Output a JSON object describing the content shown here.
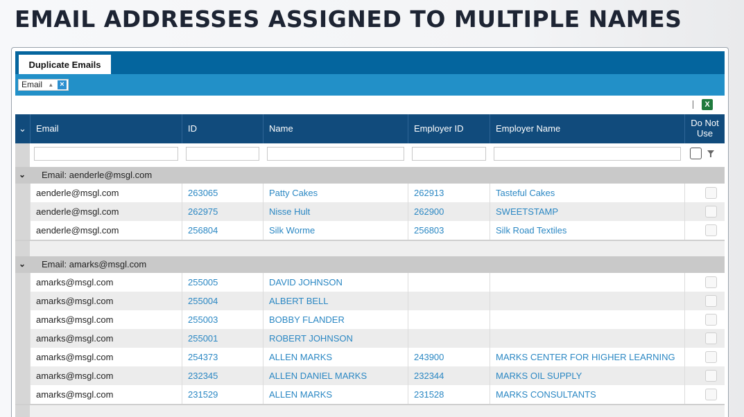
{
  "page": {
    "title": "EMAIL ADDRESSES ASSIGNED TO MULTIPLE NAMES"
  },
  "tabs": [
    {
      "label": "Duplicate Emails",
      "active": true
    }
  ],
  "grouping": {
    "chip_label": "Email",
    "sort_indicator": "▲",
    "remove_label": "×"
  },
  "toolbar": {
    "export_icon": "excel-export-icon",
    "export_glyph": "X"
  },
  "columns": {
    "toggle_glyph": "⌄",
    "email": "Email",
    "id": "ID",
    "name": "Name",
    "employer_id": "Employer ID",
    "employer_name": "Employer Name",
    "do_not_use_line1": "Do Not",
    "do_not_use_line2": "Use"
  },
  "groups": [
    {
      "label": "Email: aenderle@msgl.com",
      "chevron": "⌄",
      "rows": [
        {
          "email": "aenderle@msgl.com",
          "id": "263065",
          "name": "Patty Cakes",
          "employer_id": "262913",
          "employer_name": "Tasteful Cakes"
        },
        {
          "email": "aenderle@msgl.com",
          "id": "262975",
          "name": "Nisse Hult",
          "employer_id": "262900",
          "employer_name": "SWEETSTAMP"
        },
        {
          "email": "aenderle@msgl.com",
          "id": "256804",
          "name": "Silk Worme",
          "employer_id": "256803",
          "employer_name": "Silk Road Textiles"
        }
      ]
    },
    {
      "label": "Email: amarks@msgl.com",
      "chevron": "⌄",
      "rows": [
        {
          "email": "amarks@msgl.com",
          "id": "255005",
          "name": "DAVID JOHNSON",
          "employer_id": "",
          "employer_name": ""
        },
        {
          "email": "amarks@msgl.com",
          "id": "255004",
          "name": "ALBERT BELL",
          "employer_id": "",
          "employer_name": ""
        },
        {
          "email": "amarks@msgl.com",
          "id": "255003",
          "name": "BOBBY FLANDER",
          "employer_id": "",
          "employer_name": ""
        },
        {
          "email": "amarks@msgl.com",
          "id": "255001",
          "name": "ROBERT JOHNSON",
          "employer_id": "",
          "employer_name": ""
        },
        {
          "email": "amarks@msgl.com",
          "id": "254373",
          "name": "ALLEN MARKS",
          "employer_id": "243900",
          "employer_name": "MARKS CENTER FOR HIGHER LEARNING"
        },
        {
          "email": "amarks@msgl.com",
          "id": "232345",
          "name": "ALLEN DANIEL MARKS",
          "employer_id": "232344",
          "employer_name": "MARKS OIL SUPPLY"
        },
        {
          "email": "amarks@msgl.com",
          "id": "231529",
          "name": "ALLEN MARKS",
          "employer_id": "231528",
          "employer_name": "MARKS CONSULTANTS"
        }
      ]
    }
  ],
  "colors": {
    "tabstrip": "#04659e",
    "group_bar": "#2290c8",
    "header": "#114b7c",
    "link": "#2a87c3"
  }
}
